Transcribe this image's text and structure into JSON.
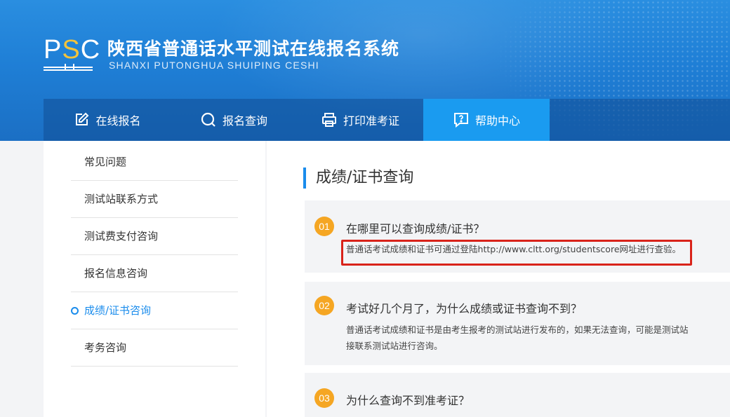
{
  "header": {
    "logo_letters": [
      "P",
      "S",
      "C"
    ],
    "title": "陕西省普通话水平测试在线报名系统",
    "subtitle": "SHANXI PUTONGHUA SHUIPING CESHI"
  },
  "nav": {
    "items": [
      {
        "label": "在线报名",
        "icon": "edit-icon"
      },
      {
        "label": "报名查询",
        "icon": "search-icon"
      },
      {
        "label": "打印准考证",
        "icon": "printer-icon"
      },
      {
        "label": "帮助中心",
        "icon": "help-icon",
        "active": true
      }
    ]
  },
  "sidebar": {
    "items": [
      {
        "label": "常见问题"
      },
      {
        "label": "测试站联系方式"
      },
      {
        "label": "测试费支付咨询"
      },
      {
        "label": "报名信息咨询"
      },
      {
        "label": "成绩/证书咨询",
        "active": true
      },
      {
        "label": "考务咨询"
      }
    ]
  },
  "main": {
    "title": "成绩/证书查询",
    "faqs": [
      {
        "num": "01",
        "question": "在哪里可以查询成绩/证书？",
        "answer_prefix": "普通话考试成绩和证书可通过登陆",
        "answer_link": "http://www.cltt.org/studentscore",
        "answer_suffix": "网址进行查验。"
      },
      {
        "num": "02",
        "question": "考试好几个月了，为什么成绩或证书查询不到？",
        "answer_line1": "普通话考试成绩和证书是由考生报考的测试站进行发布的，如果无法查询，可能是测试站",
        "answer_line2": "接联系测试站进行咨询。"
      },
      {
        "num": "03",
        "question": "为什么查询不到准考证？"
      }
    ]
  },
  "colors": {
    "accent": "#1a8cec",
    "badge": "#f5a623",
    "highlight_box": "#d9231a",
    "banner": "#1f7fd6"
  }
}
